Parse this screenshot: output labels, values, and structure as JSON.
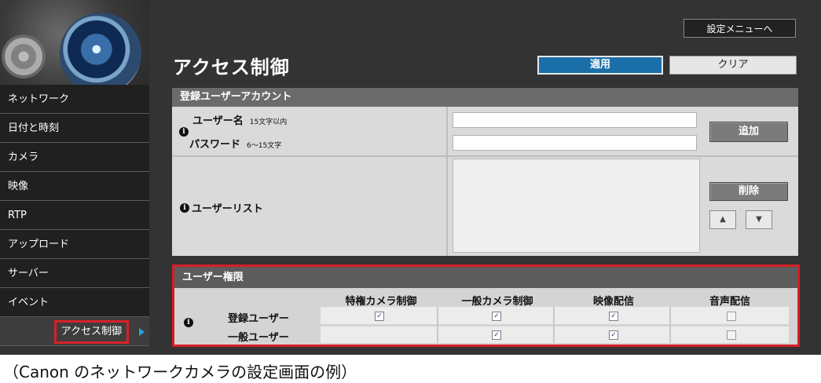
{
  "header": {
    "menu_button": "設定メニューへ",
    "title": "アクセス制御",
    "apply_label": "適用",
    "clear_label": "クリア"
  },
  "sidebar": {
    "items": [
      {
        "label": "ネットワーク"
      },
      {
        "label": "日付と時刻"
      },
      {
        "label": "カメラ"
      },
      {
        "label": "映像"
      },
      {
        "label": "RTP"
      },
      {
        "label": "アップロード"
      },
      {
        "label": "サーバー"
      },
      {
        "label": "イベント"
      },
      {
        "label": "アクセス制御",
        "active": true
      }
    ]
  },
  "account": {
    "heading": "登録ユーザーアカウント",
    "username_label": "ユーザー名",
    "username_hint": "15文字以内",
    "username_value": "",
    "password_label": "パスワード",
    "password_hint": "6～15文字",
    "password_value": "",
    "add_label": "追加",
    "user_list_label": "ユーザーリスト",
    "delete_label": "削除",
    "up_label": "▲",
    "down_label": "▼"
  },
  "permissions": {
    "heading": "ユーザー権限",
    "columns": [
      "特権カメラ制御",
      "一般カメラ制御",
      "映像配信",
      "音声配信"
    ],
    "rows": [
      {
        "label": "登録ユーザー",
        "checks": [
          true,
          true,
          true,
          false
        ]
      },
      {
        "label": "一般ユーザー",
        "checks": [
          null,
          true,
          true,
          false
        ]
      }
    ]
  },
  "caption": "（Canon のネットワークカメラの設定画面の例）",
  "colors": {
    "accent_blue": "#1b6fa8",
    "highlight_red": "#d41f27",
    "background": "#333333"
  }
}
